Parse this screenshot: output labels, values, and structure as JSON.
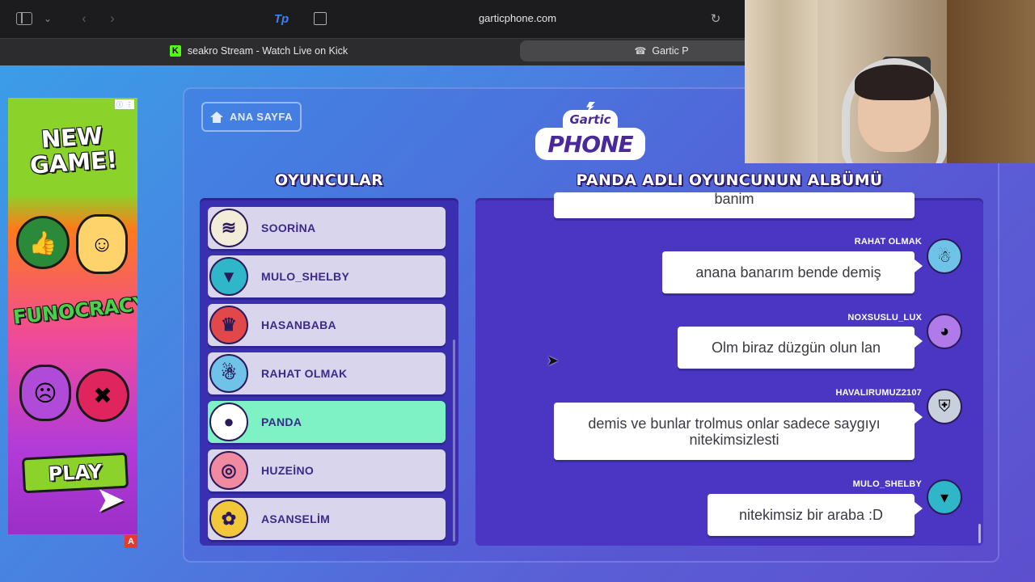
{
  "browser": {
    "url": "garticphone.com",
    "tabs": [
      {
        "label": "seakro Stream - Watch Live on Kick"
      },
      {
        "label": "Gartic P"
      }
    ]
  },
  "ad": {
    "headline": "NEW GAME!",
    "brand": "FUNOCRACY",
    "cta": "PLAY",
    "badge": "A"
  },
  "game": {
    "home_label": "ANA SAYFA",
    "logo_top": "Gartic",
    "logo_main": "PHONE",
    "players_title": "OYUNCULAR",
    "album_title": "PANDA ADLI OYUNCUNUN ALBÜMÜ",
    "players": [
      {
        "name": "SOORİNA",
        "avatar": "mummy-avatar-icon",
        "glyph": "≋",
        "color": "#f3ecd8",
        "active": false
      },
      {
        "name": "MULO_SHELBY",
        "avatar": "vampire-avatar-icon",
        "glyph": "▾",
        "color": "#2fb6c8",
        "active": false
      },
      {
        "name": "HASANBABA",
        "avatar": "king-avatar-icon",
        "glyph": "♛",
        "color": "#e0484a",
        "active": false
      },
      {
        "name": "RAHAT OLMAK",
        "avatar": "yeti-avatar-icon",
        "glyph": "☃",
        "color": "#6fc3e8",
        "active": false
      },
      {
        "name": "PANDA",
        "avatar": "panda-avatar-icon",
        "glyph": "●",
        "color": "#ffffff",
        "active": true
      },
      {
        "name": "HUZEİNO",
        "avatar": "nerd-avatar-icon",
        "glyph": "◎",
        "color": "#f08aa0",
        "active": false
      },
      {
        "name": "ASANSELİM",
        "avatar": "pineapple-avatar-icon",
        "glyph": "✿",
        "color": "#f2c83a",
        "active": false
      }
    ],
    "messages": [
      {
        "author": "",
        "text": "banim",
        "avatar": "",
        "glyph": "",
        "color": ""
      },
      {
        "author": "RAHAT OLMAK",
        "text": "anana banarım bende demiş",
        "avatar": "yeti-avatar-icon",
        "glyph": "☃",
        "color": "#6fc3e8"
      },
      {
        "author": "NOXSUSLU_LUX",
        "text": "Olm biraz düzgün olun lan",
        "avatar": "bird-avatar-icon",
        "glyph": "◕",
        "color": "#b07ae8"
      },
      {
        "author": "HAVALIRUMUZ2107",
        "text": "demis ve bunlar trolmus onlar sadece saygıyı nitekimsizlesti",
        "avatar": "knight-avatar-icon",
        "glyph": "⛨",
        "color": "#c8d0dc"
      },
      {
        "author": "MULO_SHELBY",
        "text": "nitekimsiz bir araba :D",
        "avatar": "vampire-avatar-icon",
        "glyph": "▾",
        "color": "#2fb6c8"
      }
    ]
  }
}
